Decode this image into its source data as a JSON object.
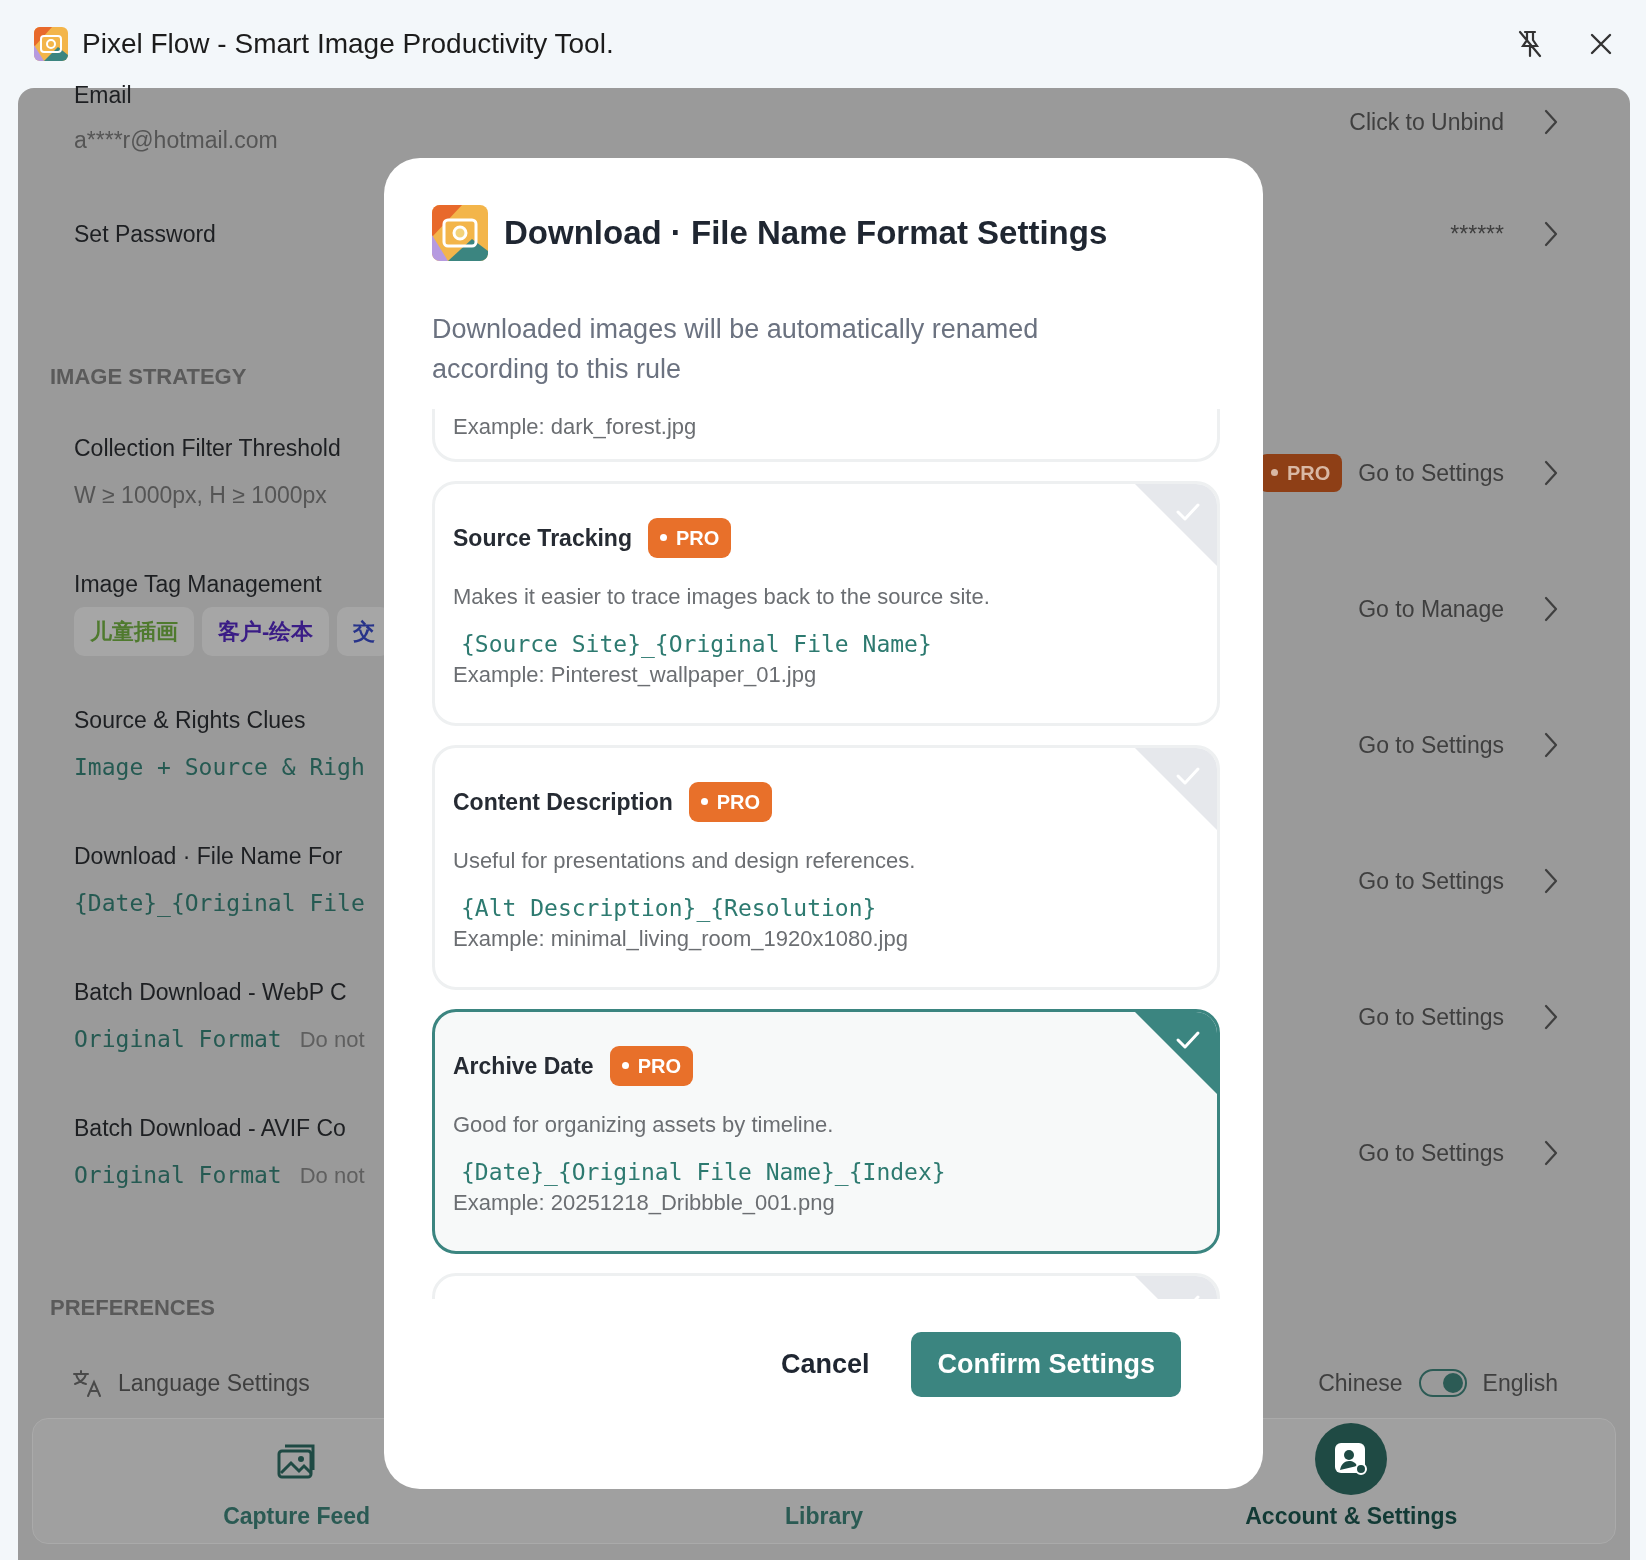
{
  "window": {
    "title": "Pixel Flow - Smart Image Productivity Tool."
  },
  "account": [
    {
      "label": "Email",
      "value": "a****r@hotmail.com",
      "action": "Click to Unbind"
    },
    {
      "label": "Set Password",
      "action": "******"
    }
  ],
  "image_strategy": {
    "heading": "IMAGE STRATEGY",
    "rows": [
      {
        "kind": "text",
        "label": "Collection Filter Threshold",
        "value": "W ≥ 1000px, H ≥ 1000px",
        "badge": "PRO",
        "action": "Go to Settings"
      },
      {
        "kind": "tags",
        "label": "Image Tag Management",
        "tags": [
          {
            "text": "儿童插画",
            "color": "#4f7a2e"
          },
          {
            "text": "客户-绘本",
            "color": "#3a1c86"
          },
          {
            "text": "交",
            "color": "#27338a"
          }
        ],
        "action": "Go to Manage"
      },
      {
        "kind": "code",
        "label": "Source & Rights Clues",
        "value": "Image + Source & Righ",
        "action": "Go to Settings"
      },
      {
        "kind": "code",
        "label": "Download · File Name For",
        "value": "{Date}_{Original File",
        "action": "Go to Settings"
      },
      {
        "kind": "code",
        "label": "Batch Download - WebP C",
        "value": "Original Format",
        "note": "Do not",
        "action": "Go to Settings"
      },
      {
        "kind": "code",
        "label": "Batch Download - AVIF Co",
        "value": "Original Format",
        "note": "Do not",
        "action": "Go to Settings"
      }
    ]
  },
  "preferences": {
    "heading": "PREFERENCES",
    "rows": [
      {
        "label": "Language Settings",
        "left": "Chinese",
        "right": "English",
        "on": true
      }
    ]
  },
  "nav": [
    {
      "label": "Capture Feed",
      "selected": false
    },
    {
      "label": "Library",
      "selected": false
    },
    {
      "label": "Account & Settings",
      "selected": true
    }
  ],
  "dialog": {
    "title": "Download · File Name Format Settings",
    "description": "Downloaded images will be automatically renamed according to this rule",
    "options": [
      {
        "kind": "partial",
        "example": "Example: dark_forest.jpg",
        "selected": false
      },
      {
        "kind": "full",
        "title": "Source Tracking",
        "badge": "PRO",
        "description": "Makes it easier to trace images back to the source site.",
        "pattern": "{Source Site}_{Original File Name}",
        "example": "Example: Pinterest_wallpaper_01.jpg",
        "selected": false
      },
      {
        "kind": "full",
        "title": "Content Description",
        "badge": "PRO",
        "description": "Useful for presentations and design references.",
        "pattern": "{Alt Description}_{Resolution}",
        "example": "Example: minimal_living_room_1920x1080.jpg",
        "selected": false
      },
      {
        "kind": "full",
        "title": "Archive Date",
        "badge": "PRO",
        "description": "Good for organizing assets by timeline.",
        "pattern": "{Date}_{Original File Name}_{Index}",
        "example": "Example: 20251218_Dribbble_001.png",
        "selected": true
      },
      {
        "kind": "edge",
        "selected": false
      }
    ],
    "buttons": [
      {
        "label": "Cancel",
        "kind": "secondary"
      },
      {
        "label": "Confirm Settings",
        "kind": "primary"
      }
    ]
  }
}
